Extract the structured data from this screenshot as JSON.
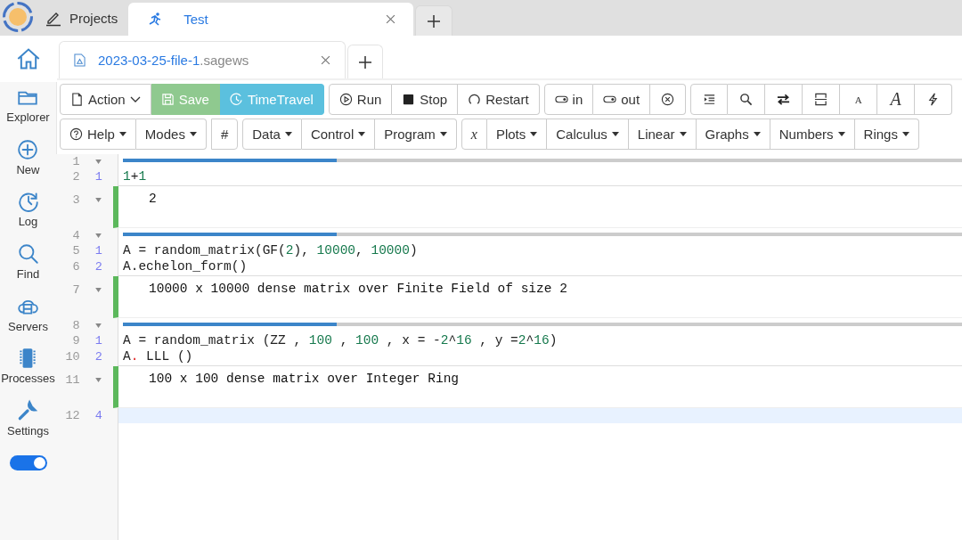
{
  "top_tabs": [
    {
      "label": "Projects",
      "kind": "projects",
      "selected": false,
      "closable": false
    },
    {
      "label": "Test",
      "kind": "project",
      "selected": true,
      "closable": true
    }
  ],
  "file_tabs": [
    {
      "name": "2023-03-25-file-1",
      "extension": ".sagews",
      "selected": true
    }
  ],
  "sidebar": {
    "items": [
      {
        "label": "Explorer",
        "kind": "folder"
      },
      {
        "label": "New",
        "kind": "plus"
      },
      {
        "label": "Log",
        "kind": "clock"
      },
      {
        "label": "Find",
        "kind": "search"
      },
      {
        "label": "Servers",
        "kind": "cloud"
      },
      {
        "label": "Processes",
        "kind": "chip"
      },
      {
        "label": "Settings",
        "kind": "wrench"
      }
    ],
    "toggle": {
      "on": true
    }
  },
  "toolbar_1": [
    [
      {
        "label": "Action",
        "kind": "file",
        "dropdown": true
      },
      {
        "label": "Save",
        "kind": "save",
        "dropdown": false
      },
      {
        "label": "TimeTravel",
        "kind": "history",
        "dropdown": false
      }
    ],
    [
      {
        "label": "Run",
        "kind": "run",
        "dropdown": false
      },
      {
        "label": "Stop",
        "kind": "stop",
        "dropdown": false
      },
      {
        "label": "Restart",
        "kind": "restart",
        "dropdown": false
      }
    ],
    [
      {
        "label": "in",
        "kind": "toggle",
        "dropdown": false
      },
      {
        "label": "out",
        "kind": "toggle",
        "dropdown": false
      },
      {
        "kind": "clear",
        "dropdown": false
      }
    ],
    [
      {
        "kind": "indent",
        "dropdown": false
      },
      {
        "kind": "search",
        "dropdown": false
      },
      {
        "kind": "swap",
        "dropdown": false
      },
      {
        "kind": "split",
        "dropdown": false
      },
      {
        "label": "A",
        "kind": "fontsmall",
        "dropdown": false
      },
      {
        "label": "A",
        "kind": "fontlarge",
        "dropdown": false
      },
      {
        "kind": "bolt",
        "dropdown": false
      }
    ]
  ],
  "toolbar_2": [
    [
      {
        "label": "Help",
        "kind": "help",
        "dropdown": true
      },
      {
        "label": "Modes",
        "kind": "text",
        "dropdown": true
      }
    ],
    [
      {
        "label": "#",
        "kind": "text",
        "dropdown": false
      }
    ],
    [
      {
        "label": "Data",
        "kind": "text",
        "dropdown": true
      },
      {
        "label": "Control",
        "kind": "text",
        "dropdown": true
      },
      {
        "label": "Program",
        "kind": "text",
        "dropdown": true
      }
    ],
    [
      {
        "label": "x",
        "kind": "math",
        "dropdown": false
      },
      {
        "label": "Plots",
        "kind": "text",
        "dropdown": true
      },
      {
        "label": "Calculus",
        "kind": "text",
        "dropdown": true
      },
      {
        "label": "Linear",
        "kind": "text",
        "dropdown": true
      },
      {
        "label": "Graphs",
        "kind": "text",
        "dropdown": true
      },
      {
        "label": "Numbers",
        "kind": "text",
        "dropdown": true
      },
      {
        "label": "Rings",
        "kind": "text",
        "dropdown": true
      }
    ]
  ],
  "editor": {
    "lines": [
      {
        "number": "1",
        "kind": "divider",
        "fold": true,
        "active": false
      },
      {
        "number": "2",
        "kind": "input",
        "prompt": "1",
        "active": false,
        "segments": [
          {
            "text": "1",
            "kind": "num"
          },
          {
            "text": "+",
            "kind": "plain"
          },
          {
            "text": "1",
            "kind": "num"
          }
        ]
      },
      {
        "number": "3",
        "kind": "output",
        "fold": true,
        "active": false,
        "text": "2"
      },
      {
        "number": "4",
        "kind": "divider",
        "fold": true,
        "active": false
      },
      {
        "number": "5",
        "kind": "input",
        "prompt": "1",
        "active": false,
        "segments": [
          {
            "text": "A = random_matrix(GF(",
            "kind": "plain"
          },
          {
            "text": "2",
            "kind": "num"
          },
          {
            "text": "), ",
            "kind": "plain"
          },
          {
            "text": "10000",
            "kind": "num"
          },
          {
            "text": ", ",
            "kind": "plain"
          },
          {
            "text": "10000",
            "kind": "num"
          },
          {
            "text": ")",
            "kind": "plain"
          }
        ]
      },
      {
        "number": "6",
        "kind": "input",
        "prompt": "2",
        "active": false,
        "segments": [
          {
            "text": "A.echelon_form()",
            "kind": "plain"
          }
        ]
      },
      {
        "number": "7",
        "kind": "output",
        "fold": true,
        "active": false,
        "text": "10000 x 10000 dense matrix over Finite Field of size 2"
      },
      {
        "number": "8",
        "kind": "divider",
        "fold": true,
        "active": false
      },
      {
        "number": "9",
        "kind": "input",
        "prompt": "1",
        "active": false,
        "segments": [
          {
            "text": "A = random_matrix (ZZ , ",
            "kind": "plain"
          },
          {
            "text": "100",
            "kind": "num"
          },
          {
            "text": " , ",
            "kind": "plain"
          },
          {
            "text": "100",
            "kind": "num"
          },
          {
            "text": " , x = -",
            "kind": "plain"
          },
          {
            "text": "2",
            "kind": "num"
          },
          {
            "text": "^",
            "kind": "plain"
          },
          {
            "text": "16",
            "kind": "num"
          },
          {
            "text": " , y =",
            "kind": "plain"
          },
          {
            "text": "2",
            "kind": "num"
          },
          {
            "text": "^",
            "kind": "plain"
          },
          {
            "text": "16",
            "kind": "num"
          },
          {
            "text": ")",
            "kind": "plain"
          }
        ]
      },
      {
        "number": "10",
        "kind": "input",
        "prompt": "2",
        "active": false,
        "segments": [
          {
            "text": "A",
            "kind": "plain"
          },
          {
            "text": ".",
            "kind": "error"
          },
          {
            "text": " LLL ()",
            "kind": "plain"
          }
        ]
      },
      {
        "number": "11",
        "kind": "output",
        "fold": true,
        "active": false,
        "text": "100 x 100 dense matrix over Integer Ring"
      },
      {
        "number": "12",
        "kind": "input",
        "prompt": "4",
        "active": true
      }
    ]
  }
}
